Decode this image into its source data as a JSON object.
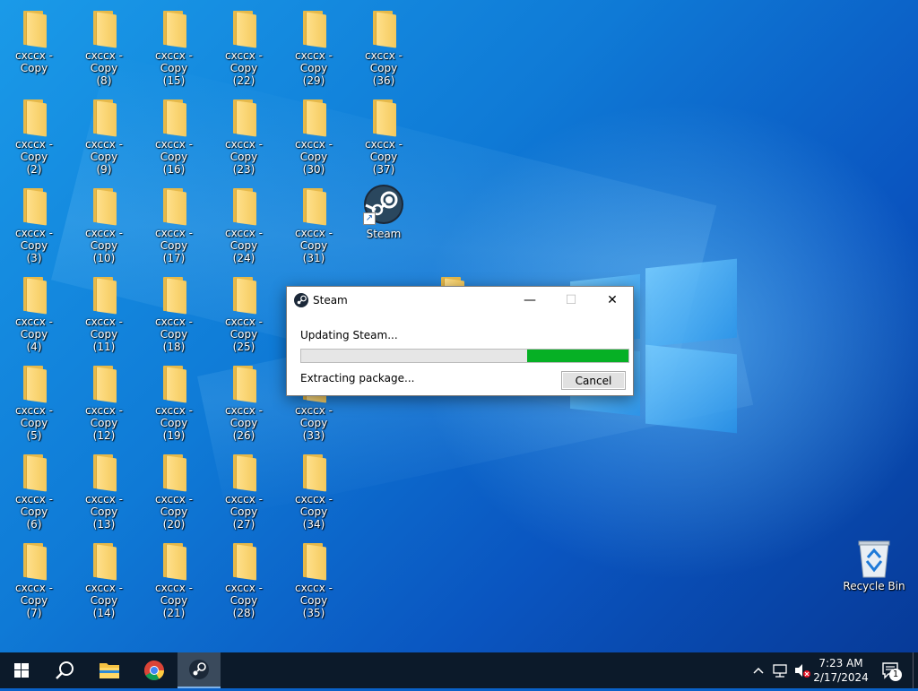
{
  "desktop": {
    "icons": [
      {
        "id": "c1",
        "label": "cxccx - Copy"
      },
      {
        "id": "c2",
        "label": "cxccx - Copy\n(2)"
      },
      {
        "id": "c3",
        "label": "cxccx - Copy\n(3)"
      },
      {
        "id": "c4",
        "label": "cxccx - Copy\n(4)"
      },
      {
        "id": "c5",
        "label": "cxccx - Copy\n(5)"
      },
      {
        "id": "c6",
        "label": "cxccx - Copy\n(6)"
      },
      {
        "id": "c7",
        "label": "cxccx - Copy\n(7)"
      },
      {
        "id": "c8",
        "label": "cxccx - Copy\n(8)"
      },
      {
        "id": "c9",
        "label": "cxccx - Copy\n(9)"
      },
      {
        "id": "c10",
        "label": "cxccx - Copy\n(10)"
      },
      {
        "id": "c11",
        "label": "cxccx - Copy\n(11)"
      },
      {
        "id": "c12",
        "label": "cxccx - Copy\n(12)"
      },
      {
        "id": "c13",
        "label": "cxccx - Copy\n(13)"
      },
      {
        "id": "c14",
        "label": "cxccx - Copy\n(14)"
      },
      {
        "id": "c15",
        "label": "cxccx - Copy\n(15)"
      },
      {
        "id": "c16",
        "label": "cxccx - Copy\n(16)"
      },
      {
        "id": "c17",
        "label": "cxccx - Copy\n(17)"
      },
      {
        "id": "c18",
        "label": "cxccx - Copy\n(18)"
      },
      {
        "id": "c19",
        "label": "cxccx - Copy\n(19)"
      },
      {
        "id": "c20",
        "label": "cxccx - Copy\n(20)"
      },
      {
        "id": "c21",
        "label": "cxccx - Copy\n(21)"
      },
      {
        "id": "c22",
        "label": "cxccx - Copy\n(22)"
      },
      {
        "id": "c23",
        "label": "cxccx - Copy\n(23)"
      },
      {
        "id": "c24",
        "label": "cxccx - Copy\n(24)"
      },
      {
        "id": "c25",
        "label": "cxccx - Copy\n(25)"
      },
      {
        "id": "c26",
        "label": "cxccx - Copy\n(26)"
      },
      {
        "id": "c27",
        "label": "cxccx - Copy\n(27)"
      },
      {
        "id": "c28",
        "label": "cxccx - Copy\n(28)"
      },
      {
        "id": "c29",
        "label": "cxccx - Copy\n(29)"
      },
      {
        "id": "c30",
        "label": "cxccx - Copy\n(30)"
      },
      {
        "id": "c31",
        "label": "cxccx - Copy\n(31)"
      },
      {
        "id": "c33",
        "label": "cxccx - Copy\n(33)"
      },
      {
        "id": "c34",
        "label": "cxccx - Copy\n(34)"
      },
      {
        "id": "c35",
        "label": "cxccx - Copy\n(35)"
      },
      {
        "id": "c36",
        "label": "cxccx - Copy\n(36)"
      },
      {
        "id": "c37",
        "label": "cxccx - Copy\n(37)"
      }
    ],
    "steam_shortcut": {
      "label": "Steam",
      "icon": "steam-icon"
    },
    "recycle_bin": {
      "label": "Recycle Bin",
      "icon": "recycle-bin-icon"
    }
  },
  "dialog": {
    "title": "Steam",
    "status": "Updating Steam...",
    "progress_fraction": 0.31,
    "substatus": "Extracting package...",
    "cancel_label": "Cancel",
    "progress_color": "#06b025"
  },
  "taskbar": {
    "items": [
      {
        "id": "start",
        "icon": "windows-start-icon"
      },
      {
        "id": "search",
        "icon": "search-icon"
      },
      {
        "id": "explorer",
        "icon": "file-explorer-icon"
      },
      {
        "id": "chrome",
        "icon": "chrome-icon"
      },
      {
        "id": "steam",
        "icon": "steam-icon",
        "active": true
      }
    ],
    "tray": {
      "time": "7:23 AM",
      "date": "2/17/2024",
      "notification_count": "1"
    }
  }
}
